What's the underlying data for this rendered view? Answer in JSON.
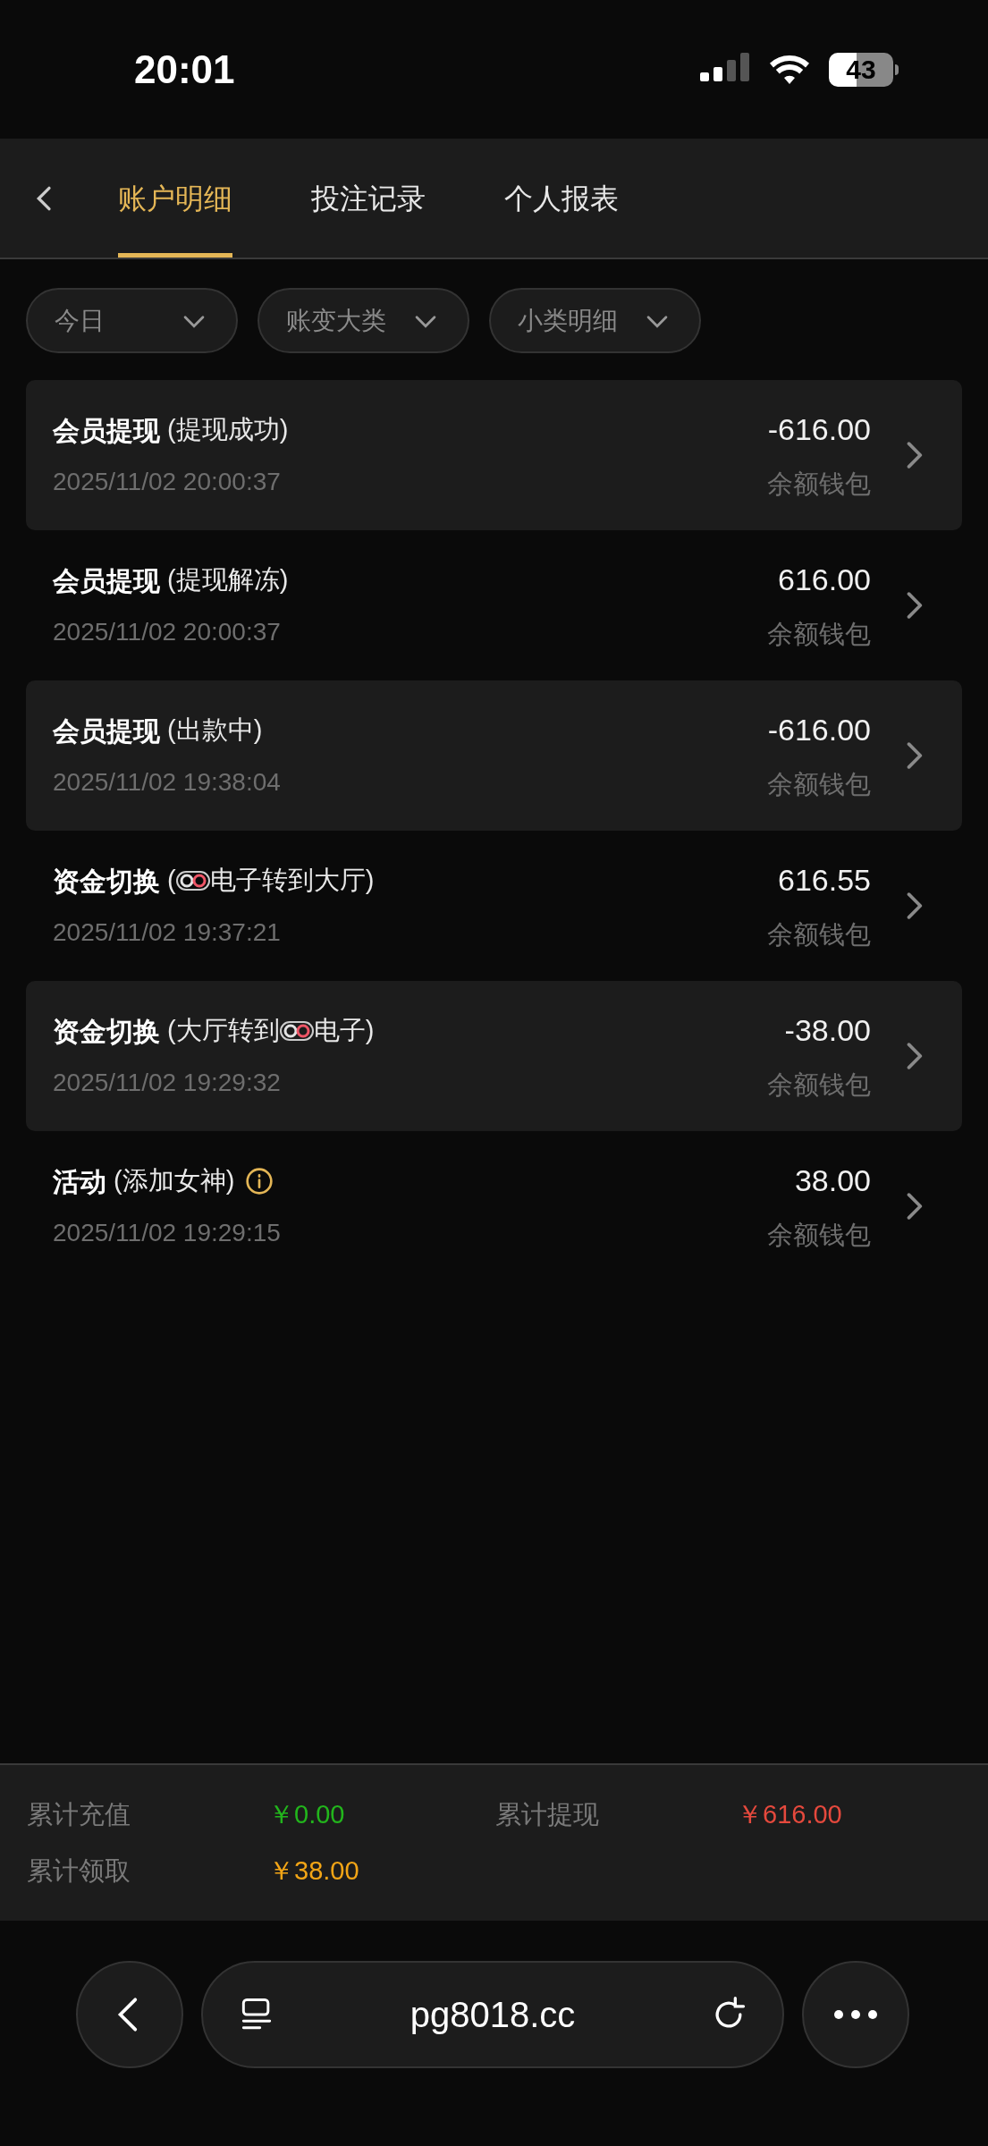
{
  "status_bar": {
    "time": "20:01",
    "battery": "43"
  },
  "tabs": [
    {
      "label": "账户明细",
      "selected": true
    },
    {
      "label": "投注记录",
      "selected": false
    },
    {
      "label": "个人报表",
      "selected": false
    }
  ],
  "filters": [
    "今日",
    "账变大类",
    "小类明细"
  ],
  "records": [
    {
      "title": "会员提现",
      "detail": [
        {
          "kind": "text",
          "text": "(提现成功)"
        }
      ],
      "info": false,
      "time": "2025/11/02 20:00:37",
      "amount": "-616.00",
      "wallet": "余额钱包"
    },
    {
      "title": "会员提现",
      "detail": [
        {
          "kind": "text",
          "text": "(提现解冻)"
        }
      ],
      "info": false,
      "time": "2025/11/02 20:00:37",
      "amount": "616.00",
      "wallet": "余额钱包"
    },
    {
      "title": "会员提现",
      "detail": [
        {
          "kind": "text",
          "text": "(出款中)"
        }
      ],
      "info": false,
      "time": "2025/11/02 19:38:04",
      "amount": "-616.00",
      "wallet": "余额钱包"
    },
    {
      "title": "资金切换",
      "detail": [
        {
          "kind": "text",
          "text": "("
        },
        {
          "kind": "logo"
        },
        {
          "kind": "text",
          "text": "电子转到大厅)"
        }
      ],
      "info": false,
      "time": "2025/11/02 19:37:21",
      "amount": "616.55",
      "wallet": "余额钱包"
    },
    {
      "title": "资金切换",
      "detail": [
        {
          "kind": "text",
          "text": "(大厅转到"
        },
        {
          "kind": "logo"
        },
        {
          "kind": "text",
          "text": "电子)"
        }
      ],
      "info": false,
      "time": "2025/11/02 19:29:32",
      "amount": "-38.00",
      "wallet": "余额钱包"
    },
    {
      "title": "活动",
      "detail": [
        {
          "kind": "text",
          "text": "(添加女神)"
        }
      ],
      "info": true,
      "time": "2025/11/02 19:29:15",
      "amount": "38.00",
      "wallet": "余额钱包"
    }
  ],
  "summary": [
    {
      "label": "累计充值",
      "value": "￥0.00",
      "color": "#22b51c"
    },
    {
      "label": "累计提现",
      "value": "￥616.00",
      "color": "#e5493d"
    },
    {
      "label": "累计领取",
      "value": "￥38.00",
      "color": "#f2a516"
    }
  ],
  "browser": {
    "url": "pg8018.cc"
  }
}
